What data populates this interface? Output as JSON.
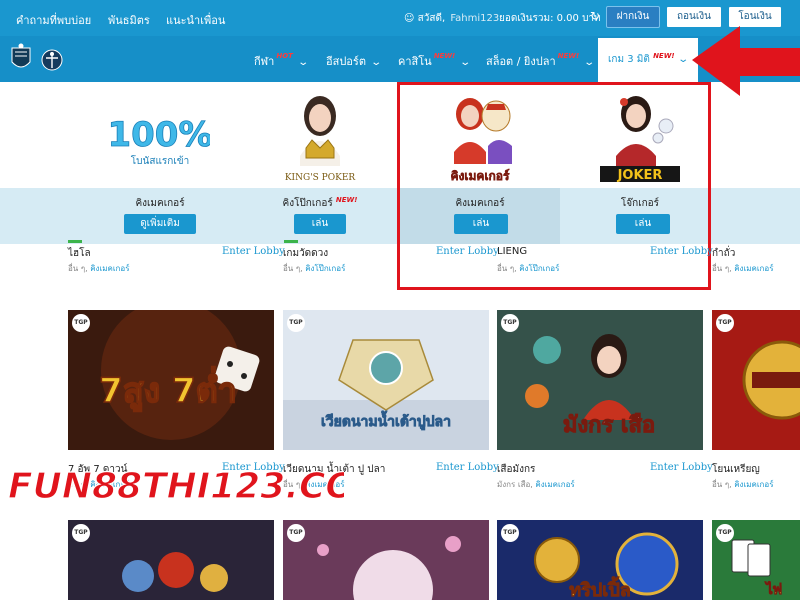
{
  "topbar": {
    "links": [
      "คำถามที่พบบ่อย",
      "พันธมิตร",
      "แนะนำเพื่อน"
    ],
    "greeting": "สวัสดี,",
    "username": "Fahmi123",
    "balance_label": "ยอดเงินรวม: 0.00 บาท",
    "deposit": "ฝากเงิน",
    "withdraw": "ถอนเงิน",
    "transfer": "โอนเงิน"
  },
  "nav": {
    "items": [
      {
        "label": "กีฬา",
        "tag": "HOT"
      },
      {
        "label": "อีสปอร์ต",
        "tag": ""
      },
      {
        "label": "คาสิโน",
        "tag": "NEW!"
      },
      {
        "label": "สล็อต / ยิงปลา",
        "tag": "NEW!"
      }
    ],
    "active": {
      "label": "เกม 3 มิติ",
      "tag": "NEW!"
    }
  },
  "dropdown": {
    "items": [
      {
        "name": "คิงเมคเกอร์",
        "tag": "",
        "button": "ดูเพิ่มเติม",
        "promo": "100%",
        "promo_sub": "โบนัสแรกเข้า"
      },
      {
        "name": "คิงโป๊กเกอร์",
        "tag": "NEW!",
        "button": "เล่น",
        "logo_text": "KING'S POKER"
      },
      {
        "name": "คิงเมคเกอร์",
        "tag": "",
        "button": "เล่น",
        "logo_text": "คิงเมคเกอร์"
      },
      {
        "name": "โจ๊กเกอร์",
        "tag": "",
        "button": "เล่น",
        "logo_text": "JOKER"
      }
    ]
  },
  "row1": [
    {
      "title": "ไฮโล",
      "sub_prefix": "อื่น ๆ,",
      "provider": "คิงเมคเกอร์"
    },
    {
      "title": "เกมวัดดวง",
      "sub_prefix": "อื่น ๆ,",
      "provider": "คิงโป๊กเกอร์"
    },
    {
      "title": "LIENG",
      "sub_prefix": "อื่น ๆ,",
      "provider": "คิงโป๊กเกอร์"
    },
    {
      "title": "กำถั่ว",
      "sub_prefix": "อื่น ๆ,",
      "provider": "คิงเมคเกอร์"
    }
  ],
  "lobby_label": "Enter Lobby",
  "tgp": "TGP",
  "row2": [
    {
      "title": "7 อัพ 7 ดาวน์",
      "sub_prefix": "อื่น ๆ,",
      "provider": "คิงเมคเกอร์",
      "art": "7สูง 7ต่ำ"
    },
    {
      "title": "เวียดนาม น้ำเต้า ปู ปลา",
      "sub_prefix": "อื่น ๆ,",
      "provider": "คิงเมคเกอร์",
      "art": "เวียดนามน้ำเต้าปูปลา"
    },
    {
      "title": "เสือมังกร",
      "sub_prefix": "มังกร เสือ,",
      "provider": "คิงเมคเกอร์",
      "art": "มังกร เสือ"
    },
    {
      "title": "โยนเหรียญ",
      "sub_prefix": "อื่น ๆ,",
      "provider": "คิงเมคเกอร์",
      "art": ""
    }
  ],
  "row3_art": [
    "",
    "",
    "ทริปเปิ้ล",
    "ไพ่"
  ],
  "watermark": "FUN88THI123.COM",
  "colors": {
    "primary": "#1a97cf",
    "highlight": "#e0141c",
    "strip": "#d6ebf4"
  }
}
